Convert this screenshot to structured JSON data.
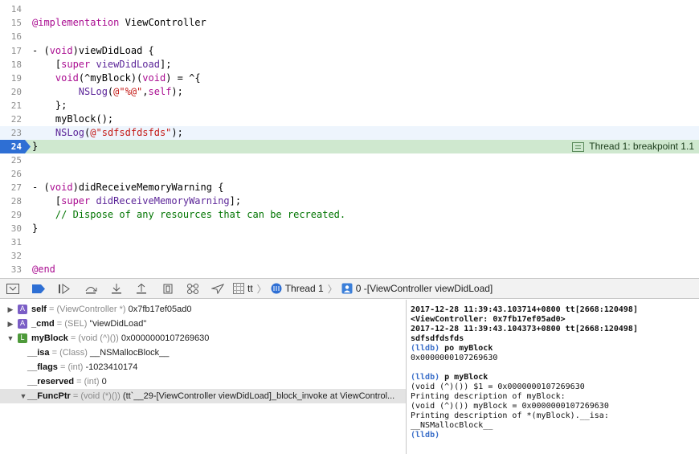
{
  "editor": {
    "lines": [
      {
        "n": "14",
        "parts": [
          {
            "t": "",
            "c": ""
          }
        ]
      },
      {
        "n": "15",
        "parts": [
          {
            "t": "@implementation",
            "c": "kw"
          },
          {
            "t": " ViewController",
            "c": ""
          }
        ]
      },
      {
        "n": "16",
        "parts": [
          {
            "t": "",
            "c": ""
          }
        ]
      },
      {
        "n": "17",
        "parts": [
          {
            "t": "- (",
            "c": ""
          },
          {
            "t": "void",
            "c": "kw"
          },
          {
            "t": ")viewDidLoad {",
            "c": ""
          }
        ]
      },
      {
        "n": "18",
        "parts": [
          {
            "t": "    [",
            "c": ""
          },
          {
            "t": "super",
            "c": "kw"
          },
          {
            "t": " ",
            "c": ""
          },
          {
            "t": "viewDidLoad",
            "c": "typ"
          },
          {
            "t": "];",
            "c": ""
          }
        ]
      },
      {
        "n": "19",
        "parts": [
          {
            "t": "    ",
            "c": ""
          },
          {
            "t": "void",
            "c": "kw"
          },
          {
            "t": "(^myBlock)(",
            "c": ""
          },
          {
            "t": "void",
            "c": "kw"
          },
          {
            "t": ") = ^{",
            "c": ""
          }
        ]
      },
      {
        "n": "20",
        "parts": [
          {
            "t": "        ",
            "c": ""
          },
          {
            "t": "NSLog",
            "c": "typ"
          },
          {
            "t": "(",
            "c": ""
          },
          {
            "t": "@\"%@\"",
            "c": "str"
          },
          {
            "t": ",",
            "c": ""
          },
          {
            "t": "self",
            "c": "kw"
          },
          {
            "t": ");",
            "c": ""
          }
        ]
      },
      {
        "n": "21",
        "parts": [
          {
            "t": "    };",
            "c": ""
          }
        ]
      },
      {
        "n": "22",
        "parts": [
          {
            "t": "    myBlock();",
            "c": ""
          }
        ]
      },
      {
        "n": "23",
        "parts": [
          {
            "t": "    ",
            "c": ""
          },
          {
            "t": "NSLog",
            "c": "typ"
          },
          {
            "t": "(",
            "c": ""
          },
          {
            "t": "@\"sdfsdfdsfds\"",
            "c": "str"
          },
          {
            "t": ");",
            "c": ""
          }
        ]
      },
      {
        "n": "24",
        "parts": [
          {
            "t": "}",
            "c": ""
          }
        ]
      },
      {
        "n": "25",
        "parts": [
          {
            "t": "",
            "c": ""
          }
        ]
      },
      {
        "n": "26",
        "parts": [
          {
            "t": "",
            "c": ""
          }
        ]
      },
      {
        "n": "27",
        "parts": [
          {
            "t": "- (",
            "c": ""
          },
          {
            "t": "void",
            "c": "kw"
          },
          {
            "t": ")didReceiveMemoryWarning {",
            "c": ""
          }
        ]
      },
      {
        "n": "28",
        "parts": [
          {
            "t": "    [",
            "c": ""
          },
          {
            "t": "super",
            "c": "kw"
          },
          {
            "t": " ",
            "c": ""
          },
          {
            "t": "didReceiveMemoryWarning",
            "c": "typ"
          },
          {
            "t": "];",
            "c": ""
          }
        ]
      },
      {
        "n": "29",
        "parts": [
          {
            "t": "    // Dispose of any resources that can be recreated.",
            "c": "cm"
          }
        ]
      },
      {
        "n": "30",
        "parts": [
          {
            "t": "}",
            "c": ""
          }
        ]
      },
      {
        "n": "31",
        "parts": [
          {
            "t": "",
            "c": ""
          }
        ]
      },
      {
        "n": "32",
        "parts": [
          {
            "t": "",
            "c": ""
          }
        ]
      },
      {
        "n": "33",
        "parts": [
          {
            "t": "@end",
            "c": "kw"
          }
        ]
      }
    ],
    "current_line": "23",
    "breakpoint_line": "24",
    "thread_label": "Thread 1: breakpoint 1.1"
  },
  "debug_bar": {
    "buttons": [
      "hide-debug-area",
      "breakpoints-toggle",
      "continue",
      "step-over",
      "step-into",
      "step-out",
      "view-debugger",
      "memory-graph",
      "simulate-location"
    ],
    "process": "tt",
    "thread": "Thread 1",
    "frame": "0 -[ViewController viewDidLoad]"
  },
  "variables": [
    {
      "indent": 0,
      "disclosure": "▶",
      "badge": "A",
      "name": "self",
      "type": "(ViewController *)",
      "value": "0x7fb17ef05ad0"
    },
    {
      "indent": 0,
      "disclosure": "▶",
      "badge": "A",
      "name": "_cmd",
      "type": "(SEL)",
      "value": "\"viewDidLoad\""
    },
    {
      "indent": 0,
      "disclosure": "▼",
      "badge": "L",
      "name": "myBlock",
      "type": "(void (^)())",
      "value": "0x0000000107269630"
    },
    {
      "indent": 1,
      "disclosure": "",
      "badge": "",
      "name": "__isa",
      "type": "(Class)",
      "value": "__NSMallocBlock__"
    },
    {
      "indent": 1,
      "disclosure": "",
      "badge": "",
      "name": "__flags",
      "type": "(int)",
      "value": "-1023410174"
    },
    {
      "indent": 1,
      "disclosure": "",
      "badge": "",
      "name": "__reserved",
      "type": "(int)",
      "value": "0"
    },
    {
      "indent": 1,
      "disclosure": "▼",
      "badge": "",
      "name": "__FuncPtr",
      "type": "(void (*)())",
      "value": "(tt`__29-[ViewController viewDidLoad]_block_invoke at ViewControl..."
    }
  ],
  "console": {
    "lines": [
      {
        "t": "2017-12-28 11:39:43.103714+0800 tt[2668:120498]",
        "s": "b"
      },
      {
        "t": "<ViewController: 0x7fb17ef05ad0>",
        "s": "b"
      },
      {
        "t": "2017-12-28 11:39:43.104373+0800 tt[2668:120498]",
        "s": "b"
      },
      {
        "t": "sdfsdfdsfds",
        "s": "b"
      },
      {
        "t": "(lldb) po myBlock",
        "s": "cmd"
      },
      {
        "t": "0x0000000107269630",
        "s": ""
      },
      {
        "t": "",
        "s": ""
      },
      {
        "t": "(lldb) p myBlock",
        "s": "cmd"
      },
      {
        "t": "(void (^)()) $1 = 0x0000000107269630",
        "s": ""
      },
      {
        "t": "Printing description of myBlock:",
        "s": ""
      },
      {
        "t": "(void (^)()) myBlock = 0x0000000107269630",
        "s": ""
      },
      {
        "t": "Printing description of *(myBlock).__isa:",
        "s": ""
      },
      {
        "t": "__NSMallocBlock__",
        "s": ""
      },
      {
        "t": "(lldb)",
        "s": "prompt"
      }
    ]
  }
}
